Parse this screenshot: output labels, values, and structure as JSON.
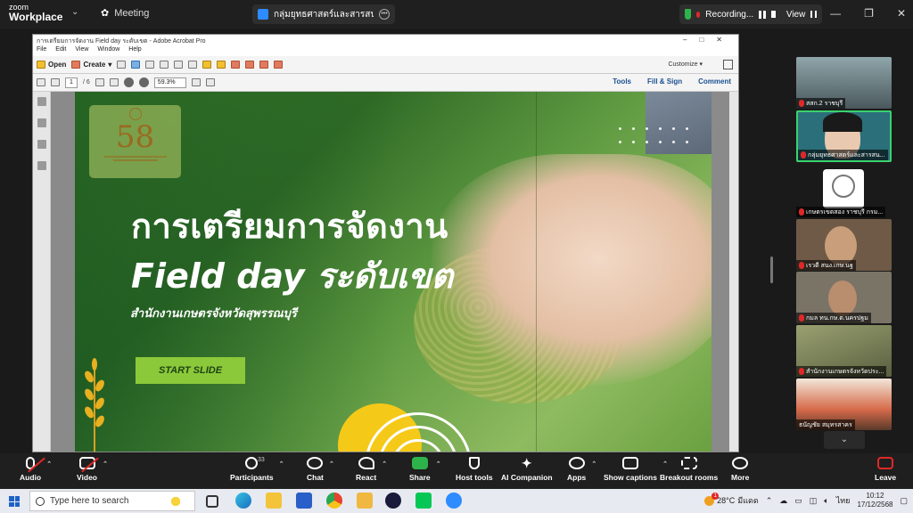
{
  "zoom_top": {
    "logo_line1": "zoom",
    "logo_line2": "Workplace",
    "meeting_label": "Meeting",
    "share_title": "กลุ่มยุทธศาสตร์และสารสนเทศ สุพรรณบ",
    "recording_label": "Recording...",
    "view_label": "View"
  },
  "acrobat": {
    "title": "การเตรียมการจัดงาน Field day ระดับเขต - Adobe Acrobat Pro",
    "menu": [
      "File",
      "Edit",
      "View",
      "Window",
      "Help"
    ],
    "open_label": "Open",
    "create_label": "Create",
    "customize_label": "Customize",
    "page_current": "1",
    "page_total": "/ 6",
    "zoom_value": "59.3%",
    "tools_label": "Tools",
    "fill_sign_label": "Fill & Sign",
    "comment_label": "Comment"
  },
  "slide": {
    "logo_number": "58",
    "title_line1": "การเตรียมการจัดงาน",
    "title_line2": "Field day ระดับเขต",
    "subtitle": "สำนักงานเกษตรจังหวัดสุพรรณบุรี",
    "start_button": "START SLIDE"
  },
  "participants": [
    {
      "name": "สสก.2 ราชบุรี",
      "muted": true,
      "bg": "#5a6a6e"
    },
    {
      "name": "กลุ่มยุทธศาสตร์และสารสน...",
      "muted": true,
      "bg": "#2b6f7a",
      "active": true
    },
    {
      "name": "เกษตรเขตสอง ราชบุรี กรม...",
      "muted": true,
      "bg": "#ffffff"
    },
    {
      "name": "เรวดี สนง.เกษ.นฐ",
      "muted": true,
      "bg": "#6f5a47"
    },
    {
      "name": "กมล ทน.กษ.ต.นครปฐม",
      "muted": true,
      "bg": "#7a7466"
    },
    {
      "name": "สำนักงานเกษตรจังหวัดประ...",
      "muted": true,
      "bg": "#7f7a4a"
    },
    {
      "name": "ธนัญชัย สมุทรสาคร",
      "muted": false,
      "bg": "#8a4f3a"
    }
  ],
  "zoom_bar": {
    "audio": "Audio",
    "video": "Video",
    "participants": "Participants",
    "participants_count": "33",
    "chat": "Chat",
    "react": "React",
    "share": "Share",
    "host_tools": "Host tools",
    "ai_companion": "AI Companion",
    "apps": "Apps",
    "show_captions": "Show captions",
    "breakout_rooms": "Breakout rooms",
    "more": "More",
    "leave": "Leave"
  },
  "taskbar": {
    "search_placeholder": "Type here to search",
    "weather_temp": "28°C",
    "weather_desc": "มีแดด",
    "notification_count": "1",
    "lang": "ไทย",
    "time": "10:12",
    "date": "17/12/2568"
  },
  "colors": {
    "zoom_bg": "#1f1f1f",
    "active_border": "#3ad26d",
    "record_red": "#e02828",
    "start_button": "#8cc93a",
    "sun": "#f5c918"
  }
}
